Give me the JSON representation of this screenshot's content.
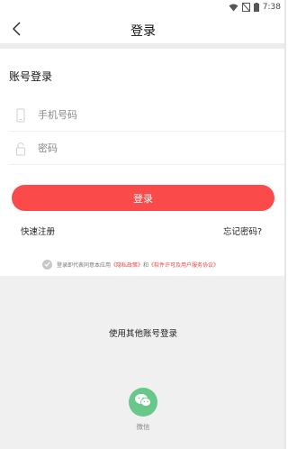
{
  "status_bar": {
    "time": "7:38",
    "icons": [
      "wifi-icon",
      "no-sim-icon",
      "battery-icon"
    ]
  },
  "header": {
    "back_icon": "chevron-left-icon",
    "title": "登录"
  },
  "login": {
    "section_title": "账号登录",
    "phone_placeholder": "手机号码",
    "password_placeholder": "密码",
    "submit_label": "登录",
    "register_label": "快速注册",
    "forgot_label": "忘记密码?"
  },
  "agreement": {
    "prefix": "登录即代表同意本应用 ",
    "privacy_link": "《隐私政策》",
    "joiner": " 和 ",
    "license_link": "《软件许可及用户服务协议》"
  },
  "other_login": {
    "title": "使用其他账号登录",
    "wechat_label": "微信"
  },
  "colors": {
    "accent": "#fb4a4a",
    "wechat": "#67c88a",
    "link": "#e94545",
    "lower_background": "#f0f0f0"
  }
}
